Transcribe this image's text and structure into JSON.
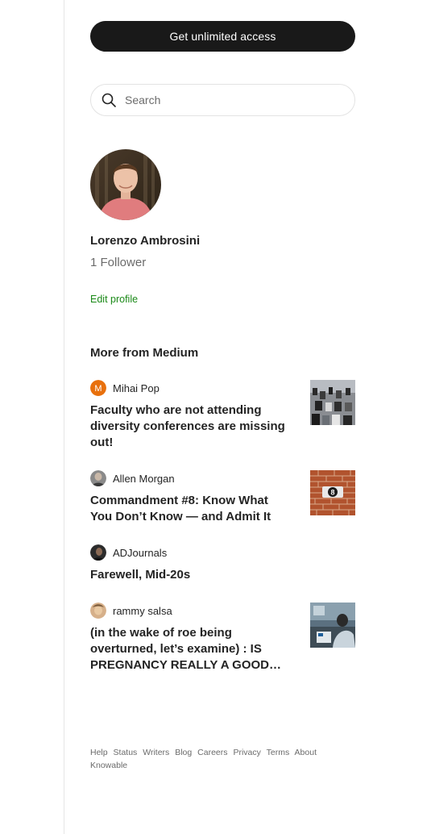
{
  "cta": {
    "label": "Get unlimited access"
  },
  "search": {
    "placeholder": "Search",
    "value": ""
  },
  "profile": {
    "name": "Lorenzo Ambrosini",
    "followers": "1 Follower",
    "edit_label": "Edit profile"
  },
  "more_from": {
    "heading": "More from Medium",
    "stories": [
      {
        "author": "Mihai Pop",
        "author_initial": "M",
        "title": "Faculty who are not attending diversity conferences are missing out!",
        "has_thumbnail": true
      },
      {
        "author": "Allen Morgan",
        "title": "Commandment #8: Know What You Don’t Know — and Admit It",
        "has_thumbnail": true,
        "thumb_label": "8"
      },
      {
        "author": "ADJournals",
        "title": "Farewell, Mid-20s",
        "has_thumbnail": false
      },
      {
        "author": "rammy salsa",
        "title": "(in the wake of roe being overturned, let’s examine) : IS PREGNANCY REALLY A GOOD…",
        "has_thumbnail": true
      }
    ]
  },
  "footer": {
    "links": [
      "Help",
      "Status",
      "Writers",
      "Blog",
      "Careers",
      "Privacy",
      "Terms",
      "About",
      "Knowable"
    ]
  },
  "colors": {
    "cta_bg": "#191919",
    "accent_green": "#1a8917",
    "muted_text": "#6b6b6b",
    "author_initial_bg": "#e8700c"
  }
}
